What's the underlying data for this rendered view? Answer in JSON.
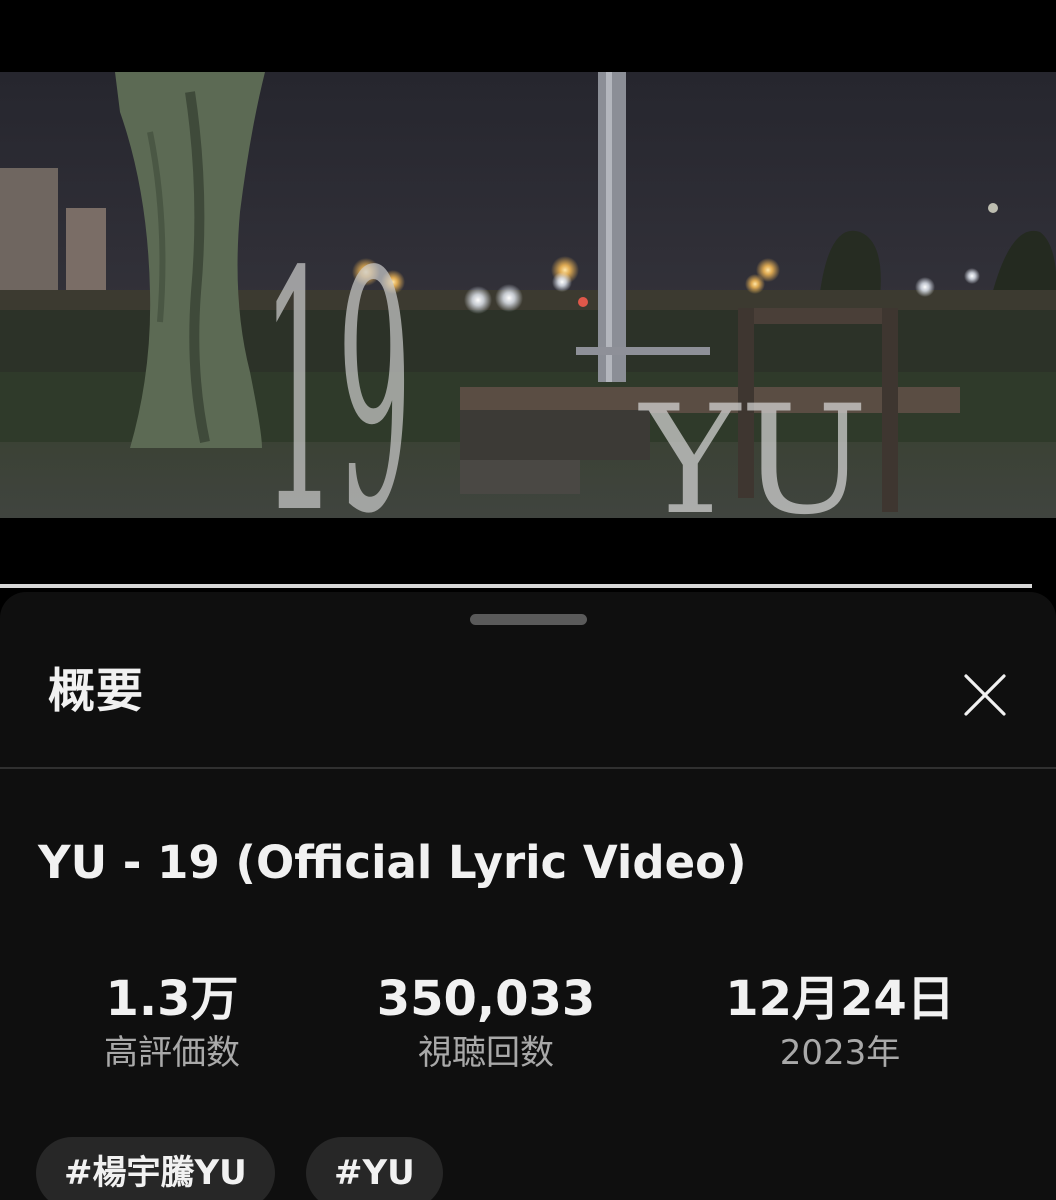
{
  "video": {
    "overlay_number": "19",
    "overlay_artist": "YU",
    "progress_fraction": 0.977
  },
  "sheet": {
    "title": "概要",
    "video_title": "YU - 19 (Official Lyric Video)",
    "stats": {
      "likes": {
        "value": "1.3万",
        "label": "高評価数"
      },
      "views": {
        "value": "350,033",
        "label": "視聴回数"
      },
      "date": {
        "value": "12月24日",
        "label": "2023年"
      }
    },
    "hashtags": [
      "#楊宇騰YU",
      "#YU"
    ]
  },
  "icons": {
    "close": "close-icon"
  }
}
